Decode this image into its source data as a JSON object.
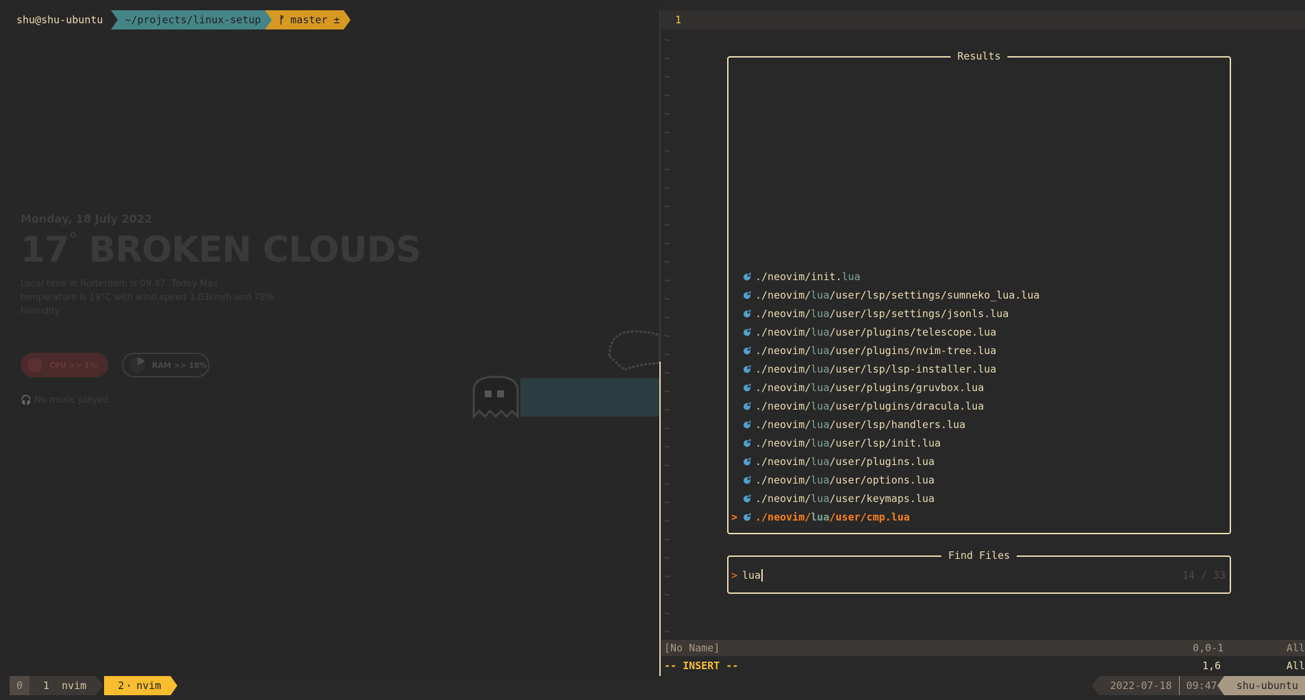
{
  "shell_prompt": {
    "user_host": "shu@shu-ubuntu",
    "path": "~/projects/linux-setup",
    "git_branch": "master ±"
  },
  "desktop_widget": {
    "date": "Monday, 18 July 2022",
    "temperature": "17",
    "degree": "°",
    "condition": "BROKEN CLOUDS",
    "description": "Local time in Rotterdam  is 09.47. Today Max temperature is 19°C with wind speed 1.03km/h and 78% humidity",
    "cpu": "CPU >> 1%",
    "ram": "RAM >> 18%",
    "ram_percent": 18,
    "music": "No music played"
  },
  "editor": {
    "line_number": "1",
    "tilde": "~",
    "tilde_count": 33
  },
  "telescope": {
    "results_title": "Results",
    "results": [
      {
        "prefix": "./neovim/init.",
        "lua": "lua",
        "suffix": "",
        "selected": false
      },
      {
        "prefix": "./neovim/",
        "lua": "lua",
        "suffix": "/user/lsp/settings/sumneko_lua.lua",
        "selected": false
      },
      {
        "prefix": "./neovim/",
        "lua": "lua",
        "suffix": "/user/lsp/settings/jsonls.lua",
        "selected": false
      },
      {
        "prefix": "./neovim/",
        "lua": "lua",
        "suffix": "/user/plugins/telescope.lua",
        "selected": false
      },
      {
        "prefix": "./neovim/",
        "lua": "lua",
        "suffix": "/user/plugins/nvim-tree.lua",
        "selected": false
      },
      {
        "prefix": "./neovim/",
        "lua": "lua",
        "suffix": "/user/lsp/lsp-installer.lua",
        "selected": false
      },
      {
        "prefix": "./neovim/",
        "lua": "lua",
        "suffix": "/user/plugins/gruvbox.lua",
        "selected": false
      },
      {
        "prefix": "./neovim/",
        "lua": "lua",
        "suffix": "/user/plugins/dracula.lua",
        "selected": false
      },
      {
        "prefix": "./neovim/",
        "lua": "lua",
        "suffix": "/user/lsp/handlers.lua",
        "selected": false
      },
      {
        "prefix": "./neovim/",
        "lua": "lua",
        "suffix": "/user/lsp/init.lua",
        "selected": false
      },
      {
        "prefix": "./neovim/",
        "lua": "lua",
        "suffix": "/user/plugins.lua",
        "selected": false
      },
      {
        "prefix": "./neovim/",
        "lua": "lua",
        "suffix": "/user/options.lua",
        "selected": false
      },
      {
        "prefix": "./neovim/",
        "lua": "lua",
        "suffix": "/user/keymaps.lua",
        "selected": false
      },
      {
        "prefix": "./neovim/",
        "lua": "lua",
        "suffix": "/user/cmp.lua",
        "selected": true
      }
    ],
    "caret": ">",
    "find_title": "Find Files",
    "query": "lua",
    "count": "14 / 33"
  },
  "nvim_status": {
    "buffer_name": "[No Name]",
    "position": "0,0-1",
    "percent": "All",
    "mode": "-- INSERT --",
    "cursor": "1,6",
    "cursor_percent": "All"
  },
  "tmux": {
    "session": "0",
    "windows": [
      {
        "index": "1",
        "name": "nvim",
        "active": false
      },
      {
        "index": "2",
        "name": "nvim",
        "active": true
      }
    ],
    "date": "2022-07-18",
    "time": "09:47",
    "host": "shu-ubuntu"
  },
  "colors": {
    "background": "#282828",
    "accent_yellow": "#fabd2f",
    "accent_orange": "#fe8019",
    "accent_blue": "#83a598",
    "lua_icon": "#51a0cf",
    "foreground": "#ebdbb2"
  }
}
